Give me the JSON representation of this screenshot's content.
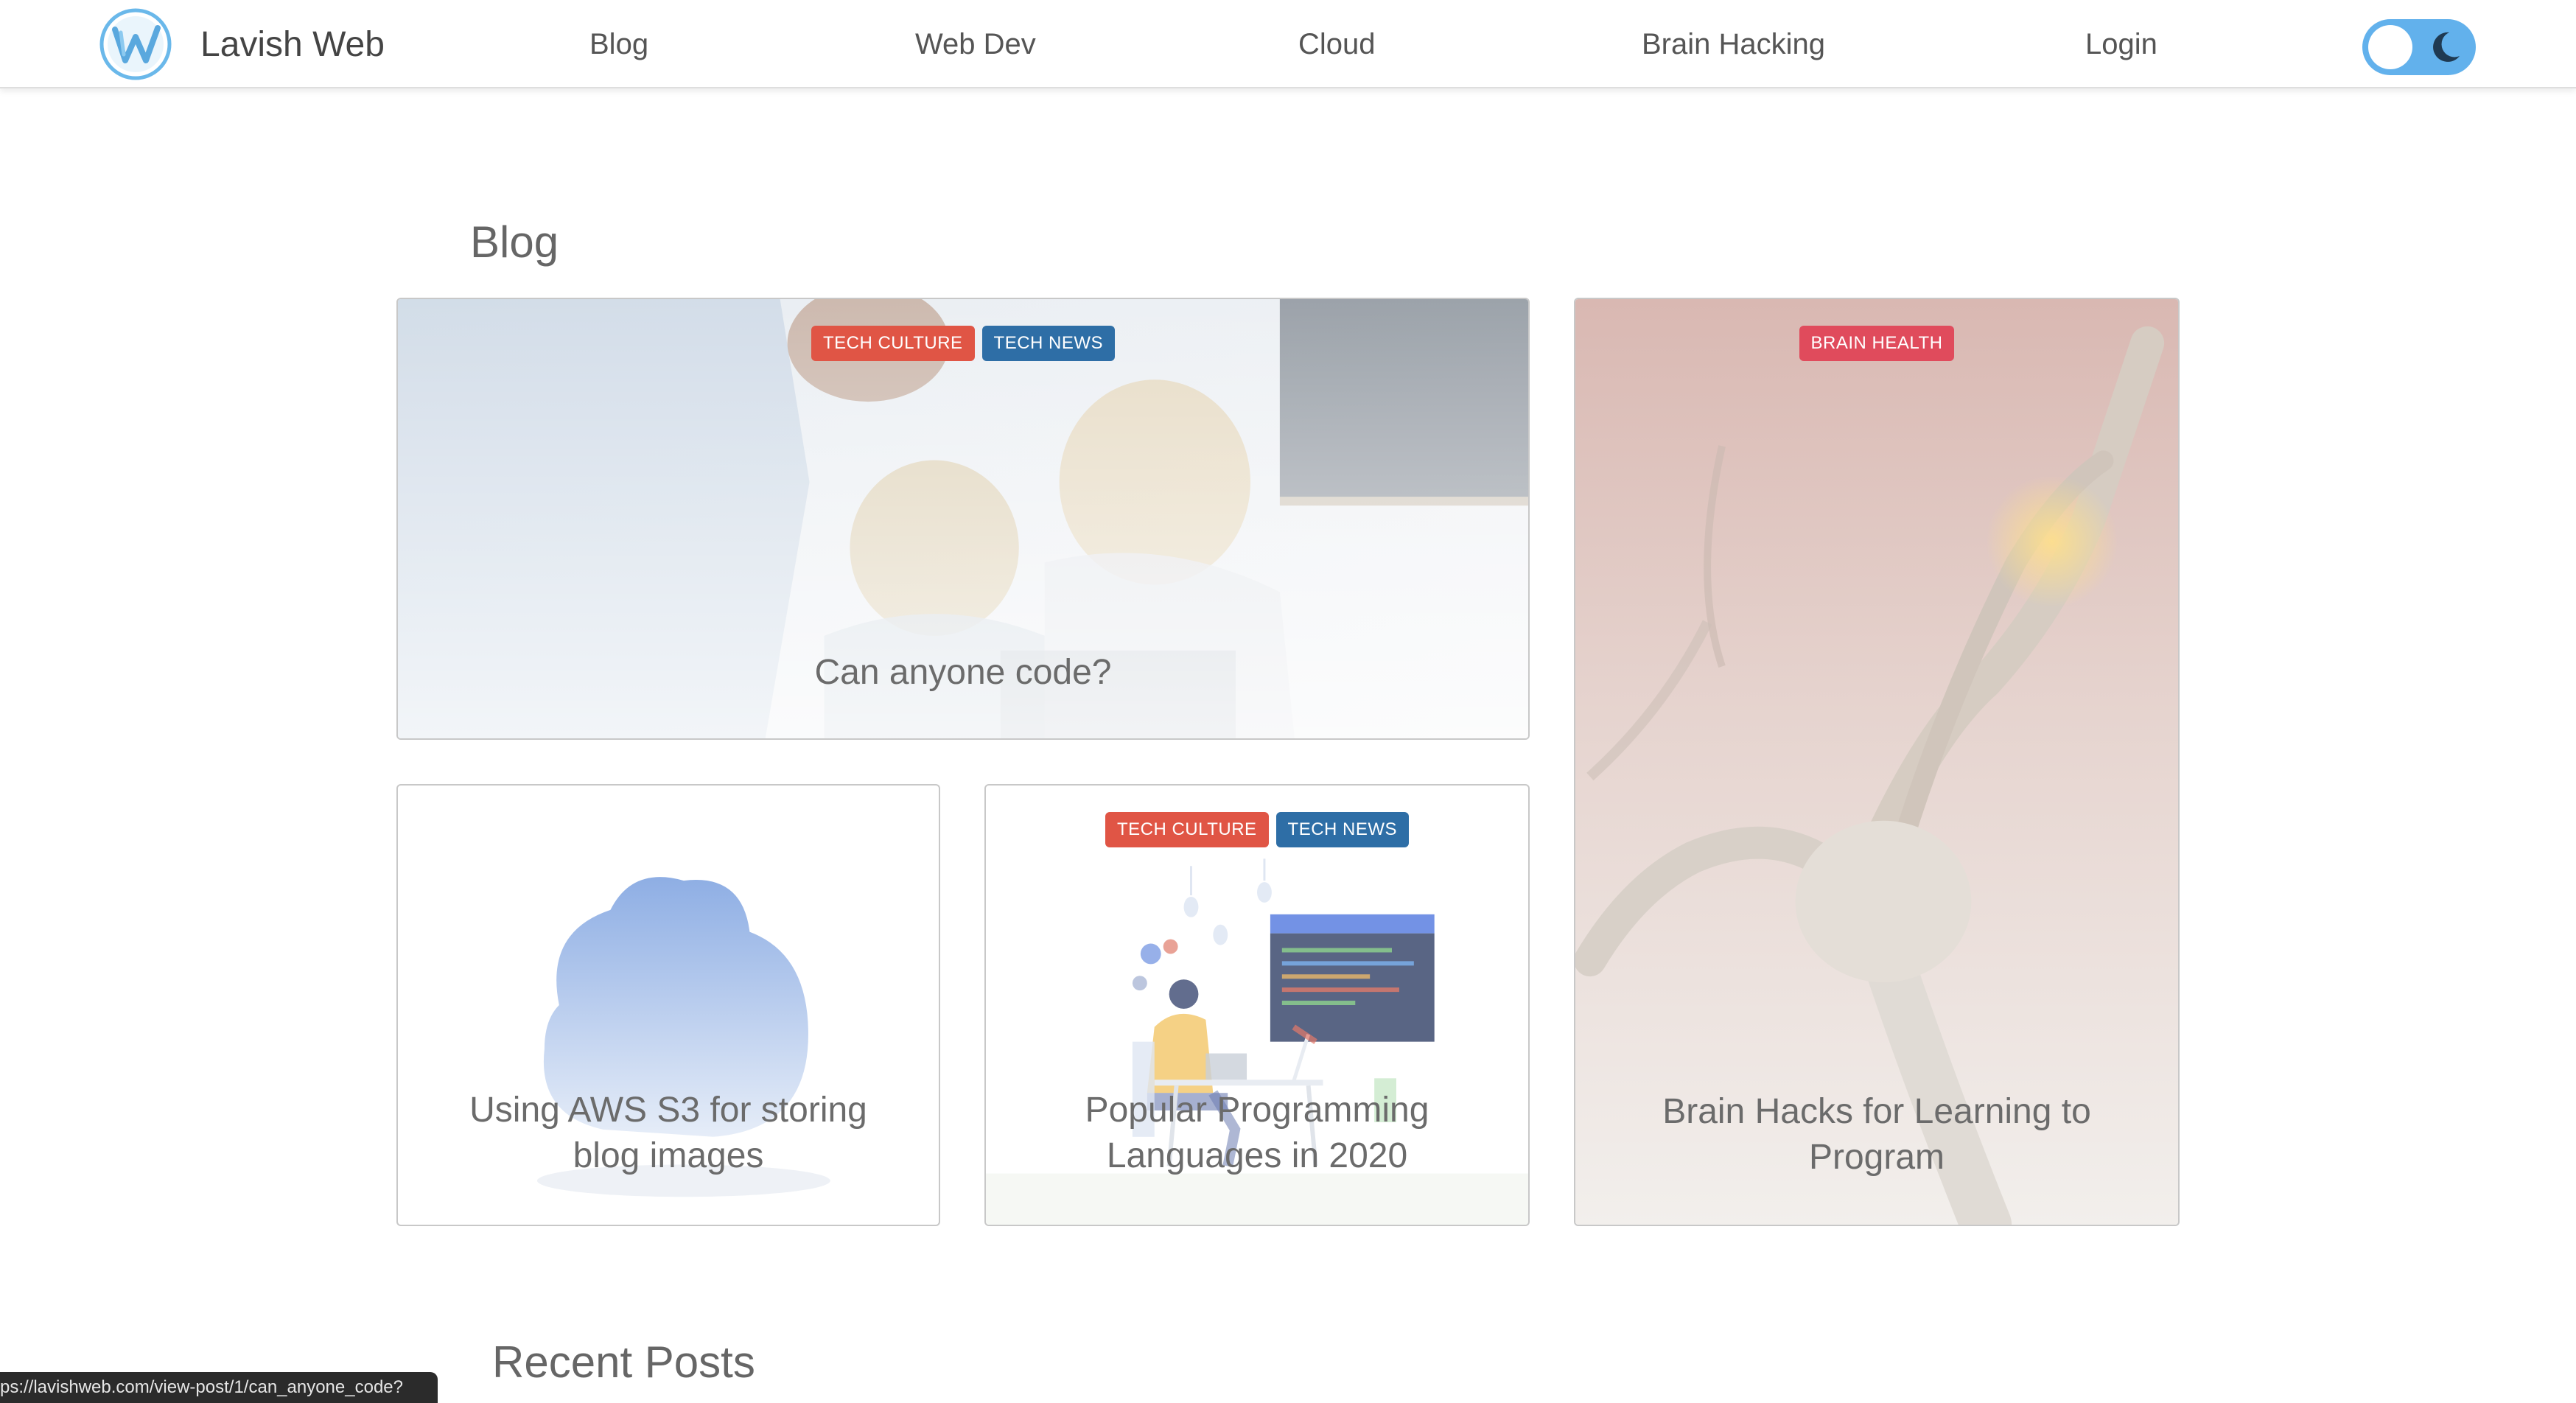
{
  "header": {
    "brand_name": "Lavish Web",
    "nav": [
      {
        "label": "Blog"
      },
      {
        "label": "Web Dev"
      },
      {
        "label": "Cloud"
      },
      {
        "label": "Brain Hacking"
      },
      {
        "label": "Login"
      }
    ],
    "theme_toggle": {
      "state": "light",
      "icon_off": "sun-knob",
      "icon_on": "moon-icon",
      "color": "#62b1ec"
    }
  },
  "main": {
    "blog_heading": "Blog",
    "cards": [
      {
        "title": "Can anyone code?",
        "badges": [
          "TECH CULTURE",
          "TECH NEWS"
        ],
        "image": "kids-coding-photo"
      },
      {
        "title": "Brain Hacks for Learning to Program",
        "badges": [
          "BRAIN HEALTH"
        ],
        "image": "neuron-photo"
      },
      {
        "title": "Using AWS S3 for storing blog images",
        "badges": [],
        "image": "cloud-illustration"
      },
      {
        "title": "Popular Programming Languages in 2020",
        "badges": [
          "TECH CULTURE",
          "TECH NEWS"
        ],
        "image": "developer-illustration"
      }
    ],
    "recent_heading": "Recent Posts"
  },
  "status_bar": {
    "url": "ps://lavishweb.com/view-post/1/can_anyone_code?"
  },
  "colors": {
    "badge_red": "#e05545",
    "badge_blue": "#2e6ea6",
    "badge_pink": "#e04b5c",
    "accent": "#62b1ec"
  }
}
